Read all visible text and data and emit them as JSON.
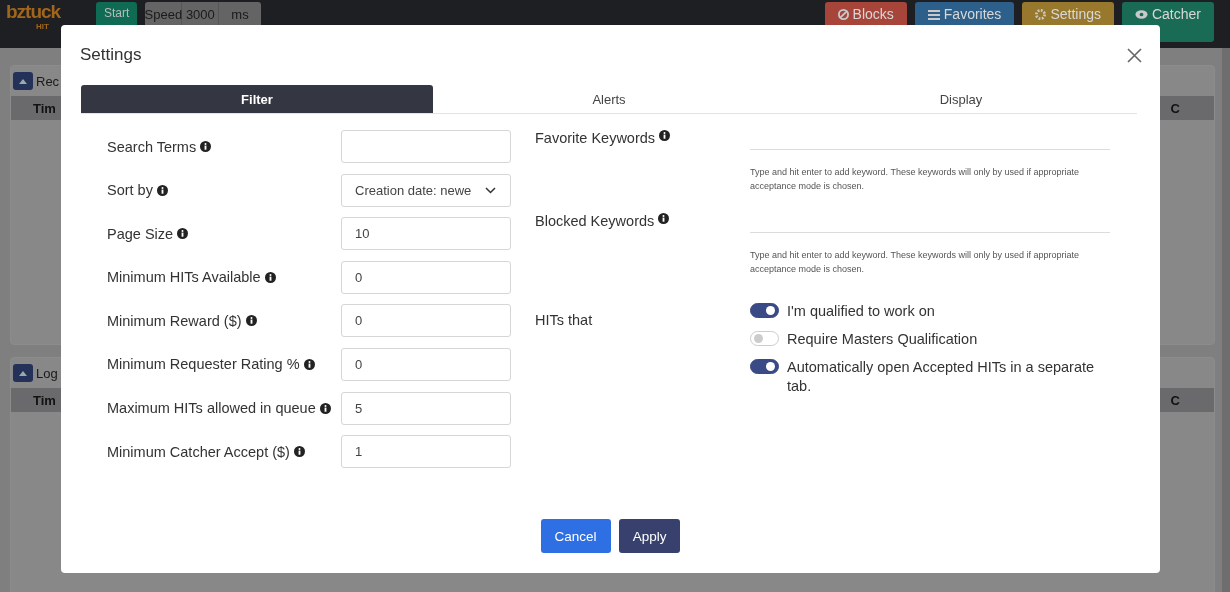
{
  "app_header": {
    "logo": "bztuck",
    "logo_sub": "HIT",
    "start_button": "Start",
    "speed": {
      "label": "Speed",
      "value": "3000",
      "unit": "ms"
    },
    "nav_buttons": [
      {
        "label": "Blocks",
        "color": "#a8453a"
      },
      {
        "label": "Favorites",
        "color": "#2c5f8a"
      },
      {
        "label": "Settings",
        "color": "#97782c"
      },
      {
        "label": "Catcher",
        "color": "#1a6b55"
      }
    ]
  },
  "panels": [
    {
      "title": "Rec",
      "column_1": "Tim",
      "column_last": "C"
    },
    {
      "title": "Log",
      "column_1": "Tim",
      "column_last": "C"
    }
  ],
  "modal": {
    "title": "Settings",
    "tabs": [
      {
        "label": "Filter",
        "selected": true
      },
      {
        "label": "Alerts",
        "selected": false
      },
      {
        "label": "Display",
        "selected": false
      }
    ],
    "fields": [
      {
        "label": "Search Terms",
        "kind": "text"
      },
      {
        "label": "Sort by",
        "kind": "select",
        "value": "Creation date: newe"
      },
      {
        "label": "Page Size",
        "kind": "text",
        "value": "10"
      },
      {
        "label": "Minimum HITs Available",
        "kind": "text",
        "value": "0"
      },
      {
        "label": "Minimum Reward ($)",
        "kind": "text",
        "value": "0"
      },
      {
        "label": "Minimum Requester Rating %",
        "kind": "text",
        "value": "0"
      },
      {
        "label": "Maximum HITs allowed in queue",
        "kind": "text",
        "value": "5"
      },
      {
        "label": "Minimum Catcher Accept ($)",
        "kind": "text",
        "value": "1"
      }
    ],
    "keywords": [
      {
        "label": "Favorite Keywords",
        "hint": "Type and hit enter to add keyword. These keywords will only by used if appropriate acceptance mode is chosen."
      },
      {
        "label": "Blocked Keywords",
        "hint": "Type and hit enter to add keyword. These keywords will only by used if appropriate acceptance mode is chosen."
      }
    ],
    "hits_label": "HITs that",
    "toggles": [
      {
        "label": "I'm qualified to work on",
        "on": true
      },
      {
        "label": "Require Masters Qualification",
        "on": false
      },
      {
        "label": "Automatically open Accepted HITs in a separate tab.",
        "on": true
      }
    ],
    "buttons": [
      {
        "label": "Cancel",
        "kind": "secondary"
      },
      {
        "label": "Apply",
        "kind": "primary"
      }
    ]
  }
}
